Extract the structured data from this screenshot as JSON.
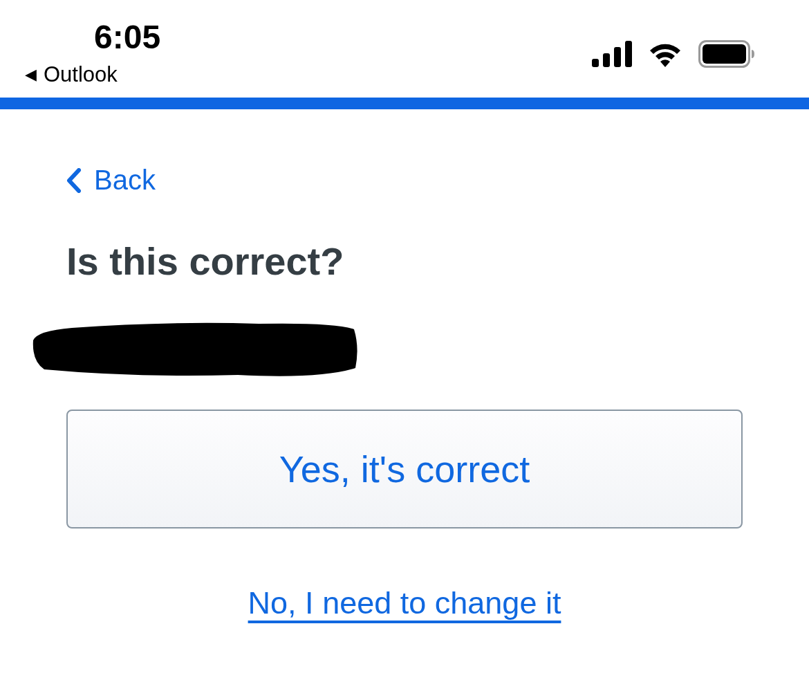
{
  "status_bar": {
    "time": "6:05",
    "back_arrow": "◀",
    "back_app": "Outlook"
  },
  "back_link": "Back",
  "heading": "Is this correct?",
  "phone_number": {
    "kind": "redacted"
  },
  "confirm_button": "Yes, it's correct",
  "change_link": "No, I need to change it"
}
